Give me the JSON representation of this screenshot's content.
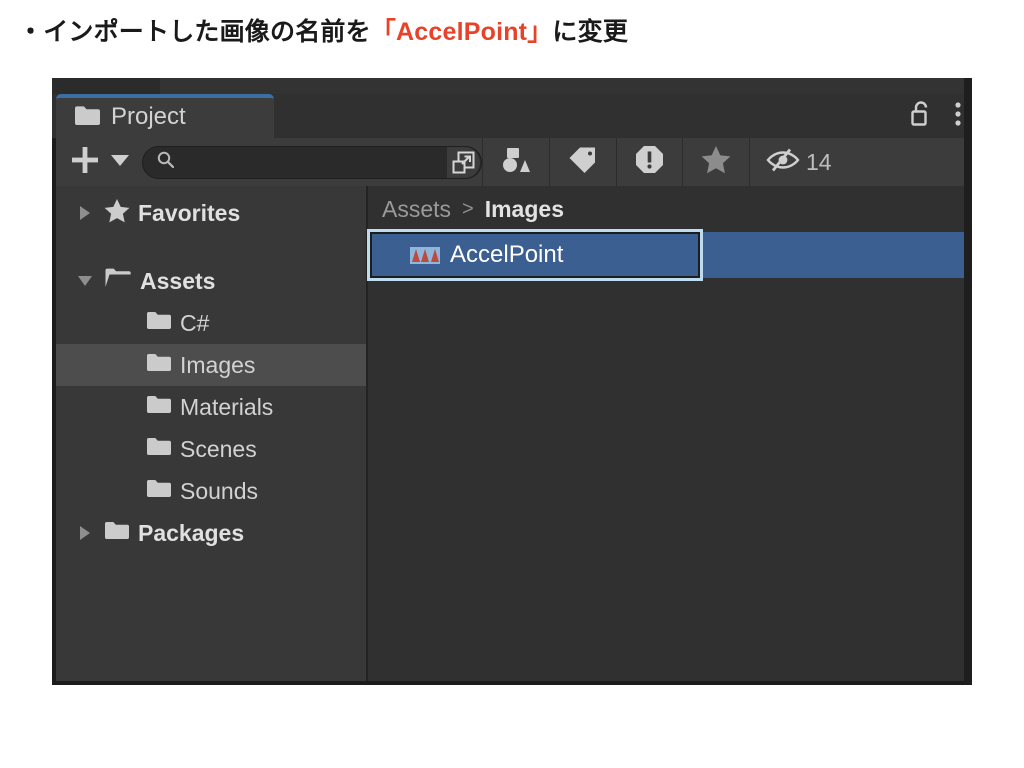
{
  "slide": {
    "bullet": "・",
    "text_before": "インポートした画像の名前を",
    "accent_text": "「AccelPoint」",
    "text_after": "に変更"
  },
  "window": {
    "tab": {
      "label": "Project",
      "icon": "folder-icon"
    },
    "tab_actions": [
      {
        "name": "lock-icon",
        "label": ""
      },
      {
        "name": "kebab-menu-icon",
        "label": ""
      }
    ],
    "toolbar": {
      "add_button_label": "+",
      "add_dropdown_icon": "chevron-down-icon",
      "search": {
        "placeholder": "",
        "value": "",
        "icon": "search-icon",
        "save_icon": "save-search-icon"
      },
      "filters": [
        {
          "name": "type-filter-icon"
        },
        {
          "name": "label-filter-icon"
        },
        {
          "name": "warning-filter-icon"
        },
        {
          "name": "favorite-filter-icon"
        }
      ],
      "hidden_items": {
        "icon": "eye-hidden-icon",
        "count": "14"
      }
    },
    "sidebar": {
      "items": [
        {
          "label": "Favorites",
          "icon": "star-icon",
          "twisty": "collapsed",
          "bold": true,
          "indent": false,
          "selected": false
        },
        {
          "label": "Assets",
          "icon": "folder-open-icon",
          "twisty": "expanded",
          "bold": true,
          "indent": false,
          "selected": false
        },
        {
          "label": "C#",
          "icon": "folder-icon",
          "twisty": "none",
          "bold": false,
          "indent": true,
          "selected": false
        },
        {
          "label": "Images",
          "icon": "folder-icon",
          "twisty": "none",
          "bold": false,
          "indent": true,
          "selected": true
        },
        {
          "label": "Materials",
          "icon": "folder-icon",
          "twisty": "none",
          "bold": false,
          "indent": true,
          "selected": false
        },
        {
          "label": "Scenes",
          "icon": "folder-icon",
          "twisty": "none",
          "bold": false,
          "indent": true,
          "selected": false
        },
        {
          "label": "Sounds",
          "icon": "folder-icon",
          "twisty": "none",
          "bold": false,
          "indent": true,
          "selected": false
        },
        {
          "label": "Packages",
          "icon": "folder-icon",
          "twisty": "collapsed",
          "bold": true,
          "indent": false,
          "selected": false
        }
      ]
    },
    "content": {
      "breadcrumb": {
        "root": "Assets",
        "separator": ">",
        "current": "Images"
      },
      "selected_asset": {
        "name": "AccelPoint",
        "renaming": true,
        "thumbnail": "sprite-thumbnail"
      }
    }
  },
  "colors": {
    "accent_red": "#E8432A",
    "tab_active_top": "#3b6ea5",
    "selection_blue": "#3b5f91",
    "rename_outline": "#bedcf0",
    "panel_bg": "#303030",
    "sidebar_bg": "#383838"
  }
}
